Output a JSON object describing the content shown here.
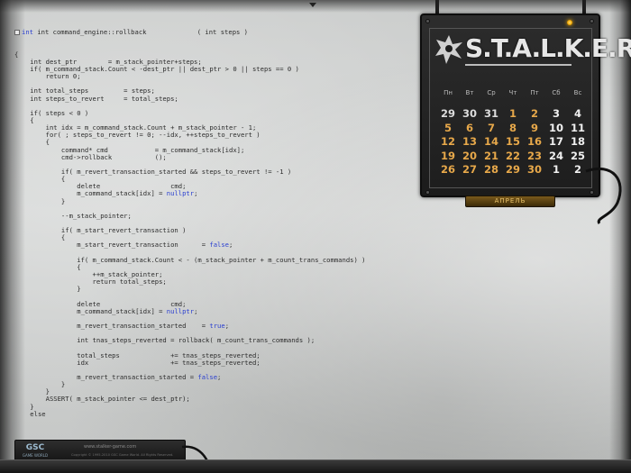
{
  "code": {
    "header": {
      "signature": "int command_engine::rollback",
      "params": "( int steps )"
    },
    "lines": [
      [
        {
          "t": "{"
        }
      ],
      [
        {
          "t": "    int dest_ptr        = m_stack_pointer+steps;"
        }
      ],
      [
        {
          "t": "    if( m_command_stack.Count < -dest_ptr || dest_ptr > 0 || steps == 0 )"
        }
      ],
      [
        {
          "t": "        return 0;"
        }
      ],
      [
        {
          "t": ""
        }
      ],
      [
        {
          "t": "    int total_steps         = steps;"
        }
      ],
      [
        {
          "t": "    int steps_to_revert     = total_steps;"
        }
      ],
      [
        {
          "t": ""
        }
      ],
      [
        {
          "t": "    if( steps < 0 )"
        }
      ],
      [
        {
          "t": "    {"
        }
      ],
      [
        {
          "t": "        int idx = m_command_stack.Count + m_stack_pointer - 1;"
        }
      ],
      [
        {
          "t": "        for( ; steps_to_revert != 0; --idx, ++steps_to_revert )"
        }
      ],
      [
        {
          "t": "        {"
        }
      ],
      [
        {
          "t": "            command* cmd            = m_command_stack[idx];"
        }
      ],
      [
        {
          "t": "            cmd->rollback           ();"
        }
      ],
      [
        {
          "t": ""
        }
      ],
      [
        {
          "t": "            if( m_revert_transaction_started && steps_to_revert != -1 )"
        }
      ],
      [
        {
          "t": "            {"
        }
      ],
      [
        {
          "t": "                delete                  cmd;"
        }
      ],
      [
        {
          "t": "                m_command_stack[idx] = "
        },
        {
          "t": "nullptr",
          "k": 1
        },
        {
          "t": ";"
        }
      ],
      [
        {
          "t": "            }"
        }
      ],
      [
        {
          "t": ""
        }
      ],
      [
        {
          "t": "            --m_stack_pointer;"
        }
      ],
      [
        {
          "t": ""
        }
      ],
      [
        {
          "t": "            if( m_start_revert_transaction )"
        }
      ],
      [
        {
          "t": "            {"
        }
      ],
      [
        {
          "t": "                m_start_revert_transaction      = "
        },
        {
          "t": "false",
          "k": 1
        },
        {
          "t": ";"
        }
      ],
      [
        {
          "t": ""
        }
      ],
      [
        {
          "t": "                if( m_command_stack.Count < - (m_stack_pointer + m_count_trans_commands) )"
        }
      ],
      [
        {
          "t": "                {"
        }
      ],
      [
        {
          "t": "                    ++m_stack_pointer;"
        }
      ],
      [
        {
          "t": "                    return total_steps;"
        }
      ],
      [
        {
          "t": "                }"
        }
      ],
      [
        {
          "t": ""
        }
      ],
      [
        {
          "t": "                delete                  cmd;"
        }
      ],
      [
        {
          "t": "                m_command_stack[idx] = "
        },
        {
          "t": "nullptr",
          "k": 1
        },
        {
          "t": ";"
        }
      ],
      [
        {
          "t": ""
        }
      ],
      [
        {
          "t": "                m_revert_transaction_started    = "
        },
        {
          "t": "true",
          "k": 1
        },
        {
          "t": ";"
        }
      ],
      [
        {
          "t": ""
        }
      ],
      [
        {
          "t": "                int tnas_steps_reverted = rollback( m_count_trans_commands );"
        }
      ],
      [
        {
          "t": ""
        }
      ],
      [
        {
          "t": "                total_steps             += tnas_steps_reverted;"
        }
      ],
      [
        {
          "t": "                idx                     += tnas_steps_reverted;"
        }
      ],
      [
        {
          "t": ""
        }
      ],
      [
        {
          "t": "                m_revert_transaction_started = "
        },
        {
          "t": "false",
          "k": 1
        },
        {
          "t": ";"
        }
      ],
      [
        {
          "t": "            }"
        }
      ],
      [
        {
          "t": "        }"
        }
      ],
      [
        {
          "t": "        ASSERT( m_stack_pointer <= dest_ptr);"
        }
      ],
      [
        {
          "t": "    }"
        }
      ],
      [
        {
          "t": "    else"
        }
      ]
    ]
  },
  "calendar": {
    "logo": "S.T.A.L.K.E.R",
    "weekdays": [
      "Пн",
      "Вт",
      "Ср",
      "Чт",
      "Пт",
      "Сб",
      "Вс"
    ],
    "weeks": [
      [
        {
          "d": "29",
          "m": "other"
        },
        {
          "d": "30",
          "m": "other"
        },
        {
          "d": "31",
          "m": "other"
        },
        {
          "d": "1",
          "m": "cur"
        },
        {
          "d": "2",
          "m": "cur"
        },
        {
          "d": "3",
          "m": "hol"
        },
        {
          "d": "4",
          "m": "hol"
        }
      ],
      [
        {
          "d": "5",
          "m": "cur"
        },
        {
          "d": "6",
          "m": "cur"
        },
        {
          "d": "7",
          "m": "cur"
        },
        {
          "d": "8",
          "m": "cur"
        },
        {
          "d": "9",
          "m": "cur"
        },
        {
          "d": "10",
          "m": "hol"
        },
        {
          "d": "11",
          "m": "hol"
        }
      ],
      [
        {
          "d": "12",
          "m": "cur"
        },
        {
          "d": "13",
          "m": "cur"
        },
        {
          "d": "14",
          "m": "cur"
        },
        {
          "d": "15",
          "m": "cur"
        },
        {
          "d": "16",
          "m": "cur"
        },
        {
          "d": "17",
          "m": "hol"
        },
        {
          "d": "18",
          "m": "hol"
        }
      ],
      [
        {
          "d": "19",
          "m": "cur"
        },
        {
          "d": "20",
          "m": "cur"
        },
        {
          "d": "21",
          "m": "cur"
        },
        {
          "d": "22",
          "m": "cur"
        },
        {
          "d": "23",
          "m": "cur"
        },
        {
          "d": "24",
          "m": "hol"
        },
        {
          "d": "25",
          "m": "hol"
        }
      ],
      [
        {
          "d": "26",
          "m": "cur"
        },
        {
          "d": "27",
          "m": "cur"
        },
        {
          "d": "28",
          "m": "cur"
        },
        {
          "d": "29",
          "m": "cur"
        },
        {
          "d": "30",
          "m": "cur"
        },
        {
          "d": "1",
          "m": "hol"
        },
        {
          "d": "2",
          "m": "hol"
        }
      ]
    ],
    "month_label": "АПРЕЛЬ"
  },
  "device": {
    "logo": "GSC",
    "logo_sub": "GAME WORLD",
    "url": "www.stalker-game.com",
    "copyright": "Copyright © 1995-2010 GSC Game World. All Rights Reserved."
  },
  "colors": {
    "keyword": "#2a3fd0",
    "current_month_day": "#e7a84a",
    "other_day": "#dcdcdc",
    "led": "#ffb400"
  }
}
